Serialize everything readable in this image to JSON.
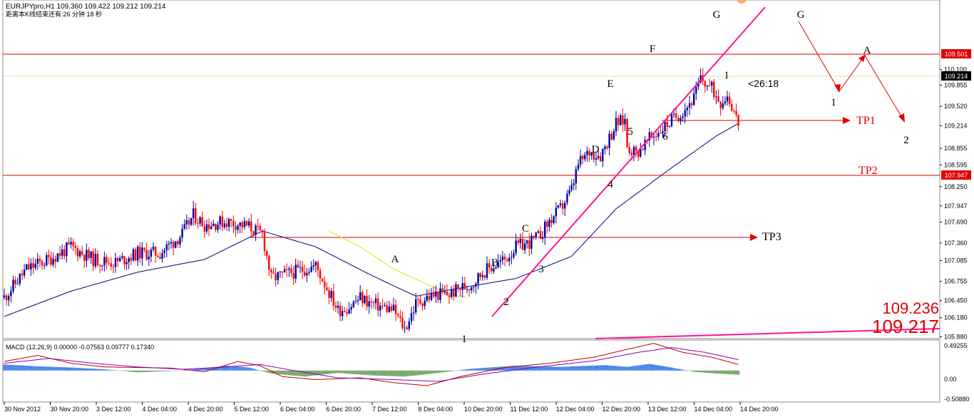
{
  "chart_data": {
    "type": "candlestick",
    "title": "EURJPYpro,H1",
    "ohlc_header": "109.360 109.422 109.212 109.214",
    "subtitle": "距离本K线结束还有:26 分钟 18 秒",
    "countdown": "<26:18",
    "ylim": [
      105.85,
      111.2
    ],
    "y_ticks": [
      "110.100",
      "109.855",
      "109.520",
      "109.214",
      "108.855",
      "108.595",
      "108.250",
      "107.947",
      "107.690",
      "107.360",
      "107.085",
      "106.755",
      "106.450",
      "106.180",
      "105.880"
    ],
    "x_ticks": [
      "30 Nov 2012",
      "30 Nov 20:00",
      "3 Dec 12:00",
      "4 Dec 04:00",
      "4 Dec 20:00",
      "5 Dec 12:00",
      "6 Dec 04:00",
      "6 Dec 20:00",
      "7 Dec 12:00",
      "8 Dec 04:00",
      "10 Dec 20:00",
      "11 Dec 12:00",
      "12 Dec 04:00",
      "12 Dec 20:00",
      "13 Dec 12:00",
      "14 Dec 04:00",
      "14 Dec 20:00"
    ],
    "key_points": [
      [
        0,
        106.5
      ],
      [
        10,
        106.95
      ],
      [
        20,
        107.1
      ],
      [
        30,
        107.3
      ],
      [
        40,
        107.1
      ],
      [
        50,
        107.05
      ],
      [
        60,
        107.2
      ],
      [
        70,
        107.2
      ],
      [
        80,
        107.5
      ],
      [
        85,
        107.8
      ],
      [
        90,
        107.65
      ],
      [
        100,
        107.7
      ],
      [
        110,
        107.62
      ],
      [
        113,
        107.55
      ],
      [
        116,
        107.5
      ],
      [
        120,
        106.8
      ],
      [
        130,
        106.9
      ],
      [
        140,
        107.0
      ],
      [
        150,
        106.3
      ],
      [
        155,
        106.35
      ],
      [
        160,
        106.5
      ],
      [
        165,
        106.4
      ],
      [
        175,
        106.3
      ],
      [
        180,
        106.0
      ],
      [
        185,
        106.4
      ],
      [
        190,
        106.5
      ],
      [
        195,
        106.55
      ],
      [
        200,
        106.55
      ],
      [
        205,
        106.65
      ],
      [
        210,
        106.7
      ],
      [
        215,
        106.9
      ],
      [
        220,
        107.0
      ],
      [
        225,
        107.1
      ],
      [
        230,
        107.3
      ],
      [
        235,
        107.35
      ],
      [
        240,
        107.45
      ],
      [
        245,
        107.7
      ],
      [
        250,
        107.9
      ],
      [
        255,
        108.2
      ],
      [
        258,
        108.6
      ],
      [
        263,
        108.8
      ],
      [
        268,
        108.75
      ],
      [
        273,
        109.1
      ],
      [
        275,
        109.25
      ],
      [
        279,
        109.3
      ],
      [
        280,
        108.9
      ],
      [
        284,
        108.78
      ],
      [
        290,
        109.0
      ],
      [
        295,
        109.15
      ],
      [
        300,
        109.3
      ],
      [
        305,
        109.45
      ],
      [
        310,
        109.65
      ],
      [
        313,
        109.95
      ],
      [
        318,
        109.8
      ],
      [
        322,
        109.6
      ],
      [
        325,
        109.7
      ],
      [
        328,
        109.45
      ],
      [
        330,
        109.214
      ]
    ],
    "ma_fast_key_points": [
      [
        0,
        106.2
      ],
      [
        30,
        106.6
      ],
      [
        60,
        106.9
      ],
      [
        90,
        107.1
      ],
      [
        116,
        107.55
      ],
      [
        140,
        107.3
      ],
      [
        165,
        106.85
      ],
      [
        185,
        106.52
      ],
      [
        205,
        106.65
      ],
      [
        230,
        106.8
      ],
      [
        255,
        107.15
      ],
      [
        275,
        107.9
      ],
      [
        300,
        108.55
      ],
      [
        320,
        109.05
      ],
      [
        330,
        109.25
      ]
    ],
    "horizontal_levels": [
      {
        "value": 109.501,
        "label": "109.501",
        "color": "#e00000"
      },
      {
        "value": 107.947,
        "label": "107.947",
        "color": "#e00000"
      },
      {
        "value": 109.214,
        "label": "109.214",
        "color": "#000000"
      }
    ],
    "tp_labels": [
      "TP1",
      "TP2",
      "TP3"
    ],
    "wave_labels_letters": [
      "A",
      "B",
      "C",
      "D",
      "E",
      "F",
      "G"
    ],
    "wave_labels_numbers": [
      "1",
      "2",
      "3",
      "4",
      "5",
      "6",
      "1"
    ],
    "projection_labels": [
      "G",
      "1",
      "A",
      "2"
    ],
    "price_labels": [
      "109.236",
      "109.217"
    ],
    "macd": {
      "label": "MACD (12,26,9) 0.00000 -0.07563 0.09777 0.17340",
      "y_ticks": [
        "0.49255",
        "0.00",
        "-0.50880"
      ],
      "ylim": [
        -0.5088,
        0.4926
      ]
    },
    "colors": {
      "up": "#0000a0",
      "down": "#ff0000",
      "ma_fast": "#000080",
      "ma_slow": "#e8e000",
      "pink": "#ff1493",
      "level": "#e00000",
      "macd_pos": "#4a86e8",
      "macd_neg": "#7aaa6e",
      "macd_main": "#c00000",
      "macd_signal": "#8000c0"
    }
  }
}
